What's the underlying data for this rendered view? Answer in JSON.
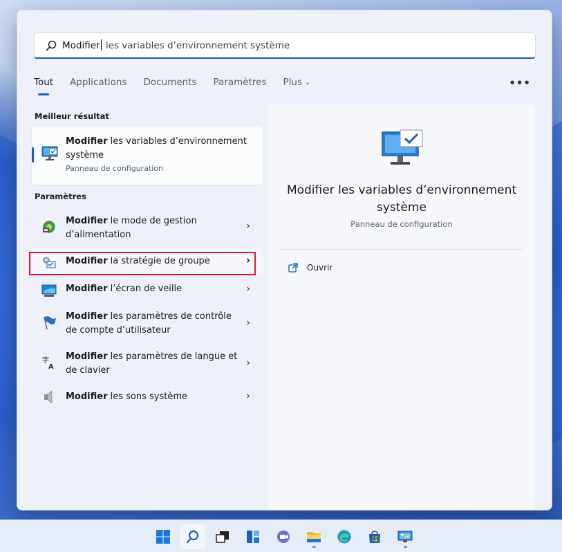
{
  "search": {
    "typed": "Modifier",
    "suggestion": " les variables d’environnement système"
  },
  "tabs": [
    {
      "label": "Tout",
      "active": true
    },
    {
      "label": "Applications",
      "active": false
    },
    {
      "label": "Documents",
      "active": false
    },
    {
      "label": "Paramètres",
      "active": false
    },
    {
      "label": "Plus",
      "active": false,
      "dropdown": true
    }
  ],
  "more_menu": "•••",
  "best": {
    "section_label": "Meilleur résultat",
    "title_bold": "Modifier",
    "title_rest": " les variables d’environnement système",
    "subtitle": "Panneau de configuration",
    "icon": "system-monitor-icon"
  },
  "settings": {
    "section_label": "Paramètres",
    "items": [
      {
        "bold": "Modifier",
        "rest": " le mode de gestion d’alimentation",
        "icon": "power-options-icon"
      },
      {
        "bold": "Modifier",
        "rest": " la stratégie de groupe",
        "icon": "group-policy-icon"
      },
      {
        "bold": "Modifier",
        "rest": " l’écran de veille",
        "icon": "screensaver-icon"
      },
      {
        "bold": "Modifier",
        "rest": " les paramètres de contrôle de compte d’utilisateur",
        "icon": "uac-flag-icon"
      },
      {
        "bold": "Modifier",
        "rest": " les paramètres de langue et de clavier",
        "icon": "language-icon"
      },
      {
        "bold": "Modifier",
        "rest": " les sons système",
        "icon": "speaker-icon"
      }
    ]
  },
  "detail": {
    "title": "Modifier les variables d’environnement système",
    "subtitle": "Panneau de configuration",
    "open_label": "Ouvrir"
  },
  "colors": {
    "accent": "#1a5fb4",
    "highlight": "#e0162b"
  },
  "taskbar": [
    "windows-start-icon",
    "search-icon",
    "task-view-icon",
    "widgets-icon",
    "chat-icon",
    "file-explorer-icon",
    "edge-icon",
    "store-icon",
    "control-panel-icon"
  ]
}
